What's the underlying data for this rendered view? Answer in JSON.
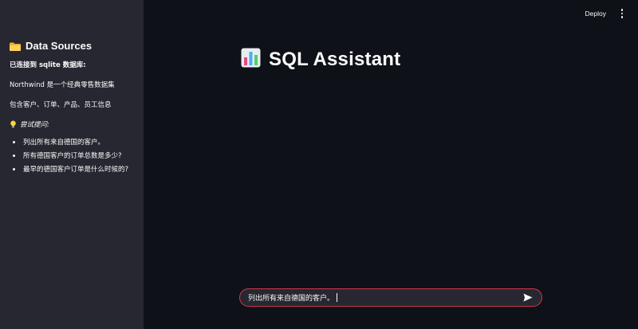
{
  "sidebar": {
    "title": "Data Sources",
    "title_icon": "folder-icon",
    "connected": "已连接到 sqlite 数据库:",
    "db_desc": "Northwind 是一个经典零售数据集",
    "db_contents": "包含客户、订单、产品、员工信息",
    "tip_icon": "lightbulb-icon",
    "tip_label": "尝试提问:",
    "examples": [
      "列出所有来自德国的客户。",
      "所有德国客户的订单总数是多少?",
      "最早的德国客户订单是什么时候的?"
    ]
  },
  "topbar": {
    "deploy_label": "Deploy",
    "menu_icon": "kebab-menu-icon"
  },
  "main": {
    "title": "SQL Assistant",
    "title_icon": "bar-chart-icon"
  },
  "chat_input": {
    "value": "列出所有来自德国的客户。",
    "send_icon": "send-icon"
  },
  "colors": {
    "background": "#0e1117",
    "sidebar": "#262730",
    "input_border": "#d0354a",
    "text": "#fafafa"
  }
}
